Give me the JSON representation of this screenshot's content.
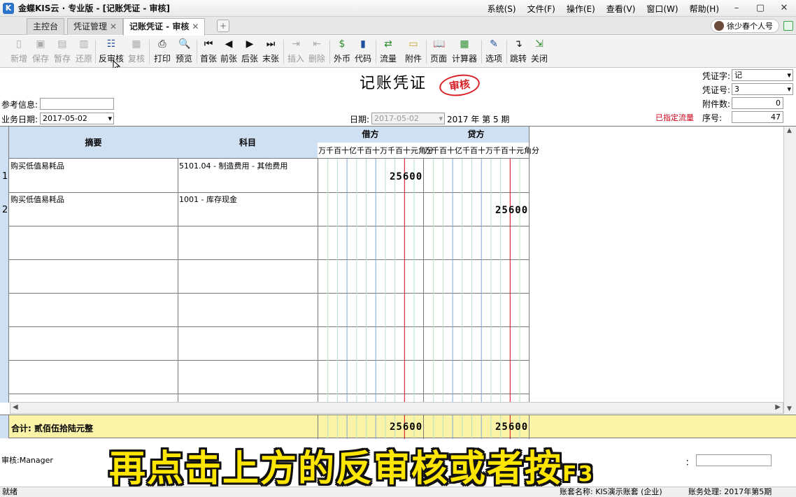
{
  "window": {
    "title": "金蝶KIS云 · 专业版 - [记账凭证 - 审核]",
    "menus": [
      "系统(S)",
      "文件(F)",
      "操作(E)",
      "查看(V)",
      "窗口(W)",
      "帮助(H)"
    ]
  },
  "tabs": [
    {
      "label": "主控台",
      "closable": false
    },
    {
      "label": "凭证管理",
      "closable": true
    },
    {
      "label": "记账凭证 - 审核",
      "closable": true,
      "active": true
    }
  ],
  "user": {
    "label": "徐少春个人号"
  },
  "toolbar": {
    "buttons": [
      {
        "label": "新增",
        "icon": "new-doc-icon",
        "disabled": true
      },
      {
        "label": "保存",
        "icon": "save-icon",
        "disabled": true
      },
      {
        "label": "暂存",
        "icon": "temp-save-icon",
        "disabled": true
      },
      {
        "label": "还原",
        "icon": "restore-icon",
        "disabled": true
      },
      {
        "label": "反审核",
        "icon": "unaudit-icon",
        "disabled": false
      },
      {
        "label": "复核",
        "icon": "recheck-icon",
        "disabled": true
      },
      {
        "label": "打印",
        "icon": "printer-icon",
        "disabled": false
      },
      {
        "label": "预览",
        "icon": "preview-icon",
        "disabled": false
      },
      {
        "label": "首张",
        "icon": "first-icon",
        "disabled": false
      },
      {
        "label": "前张",
        "icon": "prev-icon",
        "disabled": false
      },
      {
        "label": "后张",
        "icon": "next-icon",
        "disabled": false
      },
      {
        "label": "末张",
        "icon": "last-icon",
        "disabled": false
      },
      {
        "label": "插入",
        "icon": "insert-icon",
        "disabled": true
      },
      {
        "label": "删除",
        "icon": "delete-icon",
        "disabled": true
      },
      {
        "label": "外币",
        "icon": "currency-icon",
        "disabled": false
      },
      {
        "label": "代码",
        "icon": "code-icon",
        "disabled": false
      },
      {
        "label": "流量",
        "icon": "flow-icon",
        "disabled": false
      },
      {
        "label": "附件",
        "icon": "folder-icon",
        "disabled": false
      },
      {
        "label": "页面",
        "icon": "book-icon",
        "disabled": false
      },
      {
        "label": "计算器",
        "icon": "calculator-icon",
        "disabled": false
      },
      {
        "label": "选项",
        "icon": "options-icon",
        "disabled": false
      },
      {
        "label": "跳转",
        "icon": "jump-icon",
        "disabled": false
      },
      {
        "label": "关闭",
        "icon": "close-doc-icon",
        "disabled": false
      }
    ]
  },
  "form": {
    "title": "记账凭证",
    "stamp": "审核",
    "ref_label": "参考信息:",
    "ref_value": "",
    "biz_date_label": "业务日期:",
    "biz_date_value": "2017-05-02",
    "date_label": "日期:",
    "date_value": "2017-05-02",
    "period_text": "2017 年 第 5 期",
    "voucher_word_label": "凭证字:",
    "voucher_word_value": "记",
    "voucher_no_label": "凭证号:",
    "voucher_no_value": "3",
    "attach_label": "附件数:",
    "attach_value": "0",
    "seq_label": "序号:",
    "seq_value": "47",
    "flow_note": "已指定流量"
  },
  "grid": {
    "headers": {
      "summary": "摘要",
      "account": "科目",
      "debit": "借方",
      "credit": "贷方"
    },
    "digit_labels": "万千百十亿千百十万千百十元角分",
    "rows": [
      {
        "no": "1",
        "summary": "购买低值易耗品",
        "account": "5101.04 - 制造费用 - 其他费用",
        "debit": "25600",
        "credit": ""
      },
      {
        "no": "2",
        "summary": "购买低值易耗品",
        "account": "1001 - 库存现金",
        "debit": "",
        "credit": "25600"
      }
    ],
    "total_label": "合计: 贰佰伍拾陆元整",
    "total_debit": "25600",
    "total_credit": "25600"
  },
  "footer": {
    "auditor": "审核:Manager",
    "subtitle_main": "再点击上方的反审核或者按",
    "subtitle_key": "F3"
  },
  "status": {
    "left": "就绪",
    "account_set": "账套名称: KIS演示账套 (企业)",
    "period": "账务处理: 2017年第5期"
  }
}
